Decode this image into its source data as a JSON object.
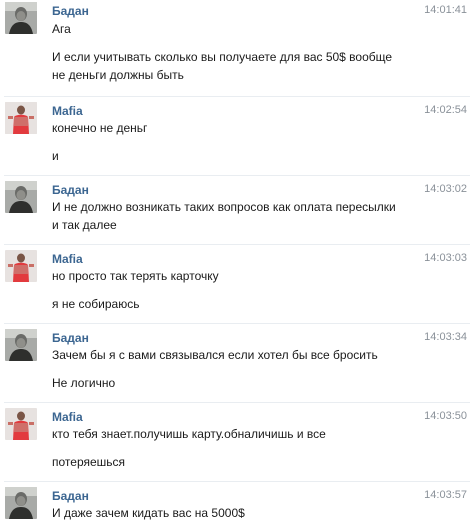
{
  "messages": [
    {
      "sender": "Бадан",
      "time": "14:01:41",
      "avatar": "avatar-badan",
      "lines": [
        "Ага",
        "И если учитывать сколько вы получаете для вас 50$ вообще",
        "не деньги должны быть"
      ]
    },
    {
      "sender": "Mafia",
      "time": "14:02:54",
      "avatar": "avatar-mafia",
      "lines": [
        "конечно не деньг",
        "и"
      ]
    },
    {
      "sender": "Бадан",
      "time": "14:03:02",
      "avatar": "avatar-badan",
      "lines": [
        "И не должно возникать таких вопросов как оплата пересылки",
        "и так далее"
      ]
    },
    {
      "sender": "Mafia",
      "time": "14:03:03",
      "avatar": "avatar-mafia",
      "lines": [
        "но просто так терять карточку",
        "я не собираюсь"
      ]
    },
    {
      "sender": "Бадан",
      "time": "14:03:34",
      "avatar": "avatar-badan",
      "lines": [
        "Зачем бы я с вами связывался если хотел бы все бросить",
        "Не логично"
      ]
    },
    {
      "sender": "Mafia",
      "time": "14:03:50",
      "avatar": "avatar-mafia",
      "lines": [
        "кто тебя знает.получишь карту.обналичишь и все",
        "потеряешься"
      ]
    },
    {
      "sender": "Бадан",
      "time": "14:03:57",
      "avatar": "avatar-badan",
      "lines": [
        "И даже зачем кидать вас на 5000$"
      ]
    }
  ],
  "colors": {
    "name": "#3c6691",
    "time": "#8a9199",
    "text": "#1a1a1a",
    "separator": "#e9edf1"
  }
}
